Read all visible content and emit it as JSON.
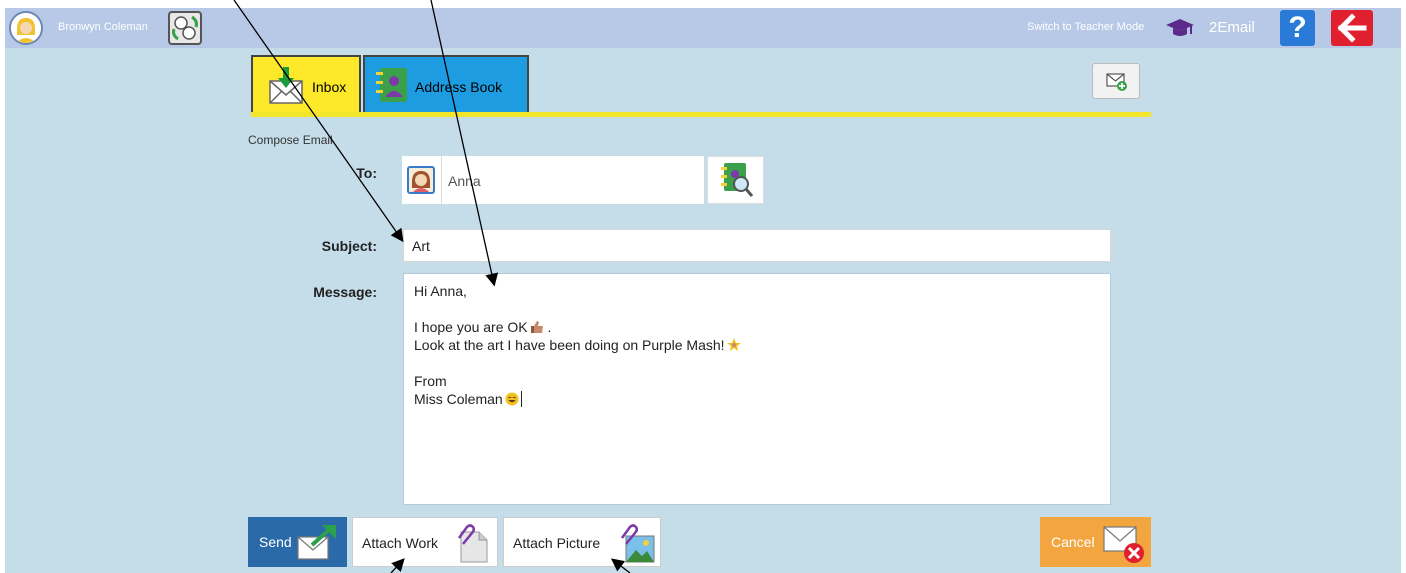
{
  "header": {
    "user_name": "Bronwyn Coleman",
    "switch_mode_label": "Switch to Teacher Mode",
    "app_name": "2Email",
    "help_label": "?"
  },
  "tabs": [
    {
      "label": "Inbox",
      "active": true
    },
    {
      "label": "Address Book",
      "active": false
    }
  ],
  "compose": {
    "title": "Compose Email",
    "to_label": "To:",
    "to_recipient": "Anna",
    "subject_label": "Subject:",
    "subject_value": "Art",
    "message_label": "Message:",
    "message_lines": [
      "Hi Anna,",
      "",
      "I hope you are OK",
      "Look at the art I have been doing on Purple Mash!",
      "",
      "From",
      "Miss Coleman"
    ]
  },
  "buttons": {
    "send": "Send",
    "attach_work": "Attach Work",
    "attach_picture": "Attach Picture",
    "cancel": "Cancel"
  },
  "colors": {
    "header_bg": "#b7c9e6",
    "main_bg": "#c4dde9",
    "inbox_tab": "#fde82a",
    "address_tab": "#1d9ce2",
    "send_btn": "#2b6aa8",
    "cancel_btn": "#f3a640",
    "help_btn": "#2a7bd8",
    "back_btn": "#e0202e"
  }
}
